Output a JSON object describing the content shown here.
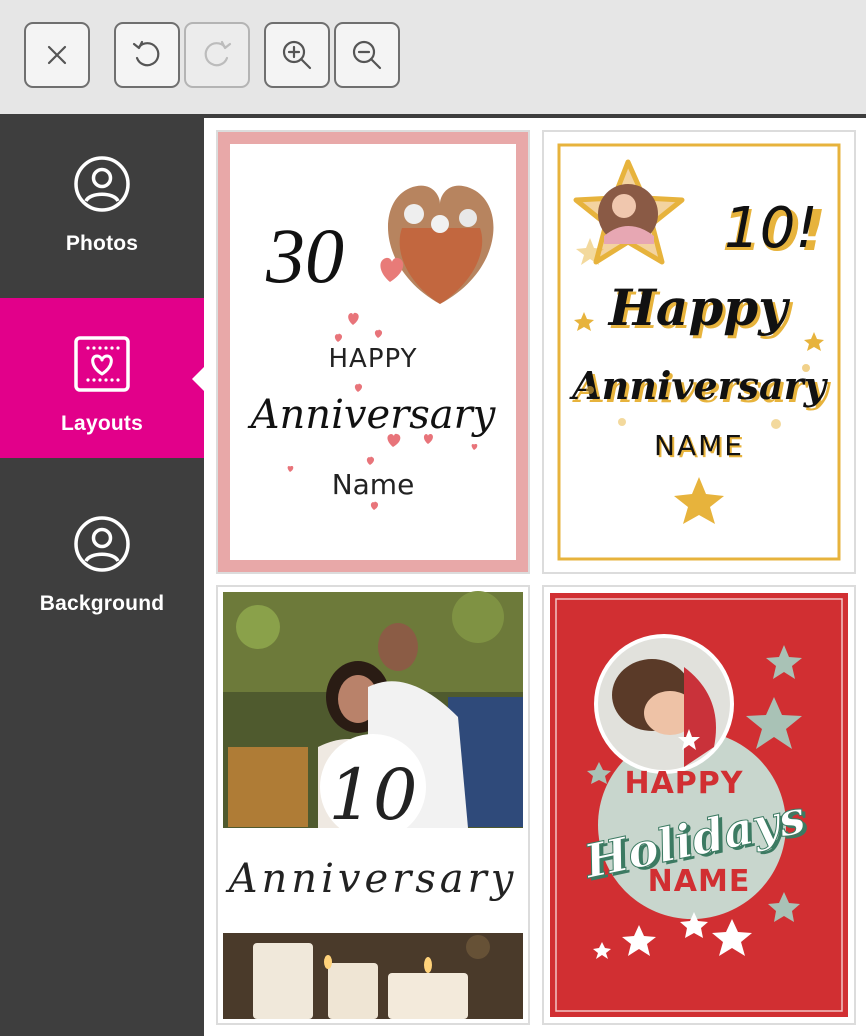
{
  "toolbar": {
    "buttons": [
      {
        "name": "close",
        "icon": "close-icon",
        "enabled": true
      },
      {
        "name": "undo",
        "icon": "undo-icon",
        "enabled": true
      },
      {
        "name": "redo",
        "icon": "redo-icon",
        "enabled": false
      },
      {
        "name": "zoom-in",
        "icon": "zoom-in-icon",
        "enabled": true
      },
      {
        "name": "zoom-out",
        "icon": "zoom-out-icon",
        "enabled": true
      }
    ]
  },
  "sidebar": {
    "items": [
      {
        "label": "Photos",
        "icon": "person-circle-icon",
        "active": false
      },
      {
        "label": "Layouts",
        "icon": "layout-heart-icon",
        "active": true
      },
      {
        "label": "Background",
        "icon": "person-circle-icon",
        "active": false
      }
    ]
  },
  "colors": {
    "accent": "#e2008a",
    "sidebar": "#3e3e3e",
    "toolbar": "#e6e6e6",
    "pink_frame": "#e8a8a8",
    "gold": "#e7b33c",
    "holiday_red": "#d12f32",
    "sage": "#c8d6cd"
  },
  "layouts": [
    {
      "name": "layout-30-anniversary",
      "number": "30",
      "line1": "HAPPY",
      "line2": "Anniversary",
      "line3": "Name"
    },
    {
      "name": "layout-10-happy-anniversary",
      "number": "10!",
      "line1": "Happy",
      "line2": "Anniversary",
      "line3": "NAME"
    },
    {
      "name": "layout-10-anniversary-photo",
      "number": "10",
      "line2": "Anniversary"
    },
    {
      "name": "layout-happy-holidays",
      "line1": "HAPPY",
      "line2": "Holidays",
      "line3": "NAME"
    }
  ]
}
